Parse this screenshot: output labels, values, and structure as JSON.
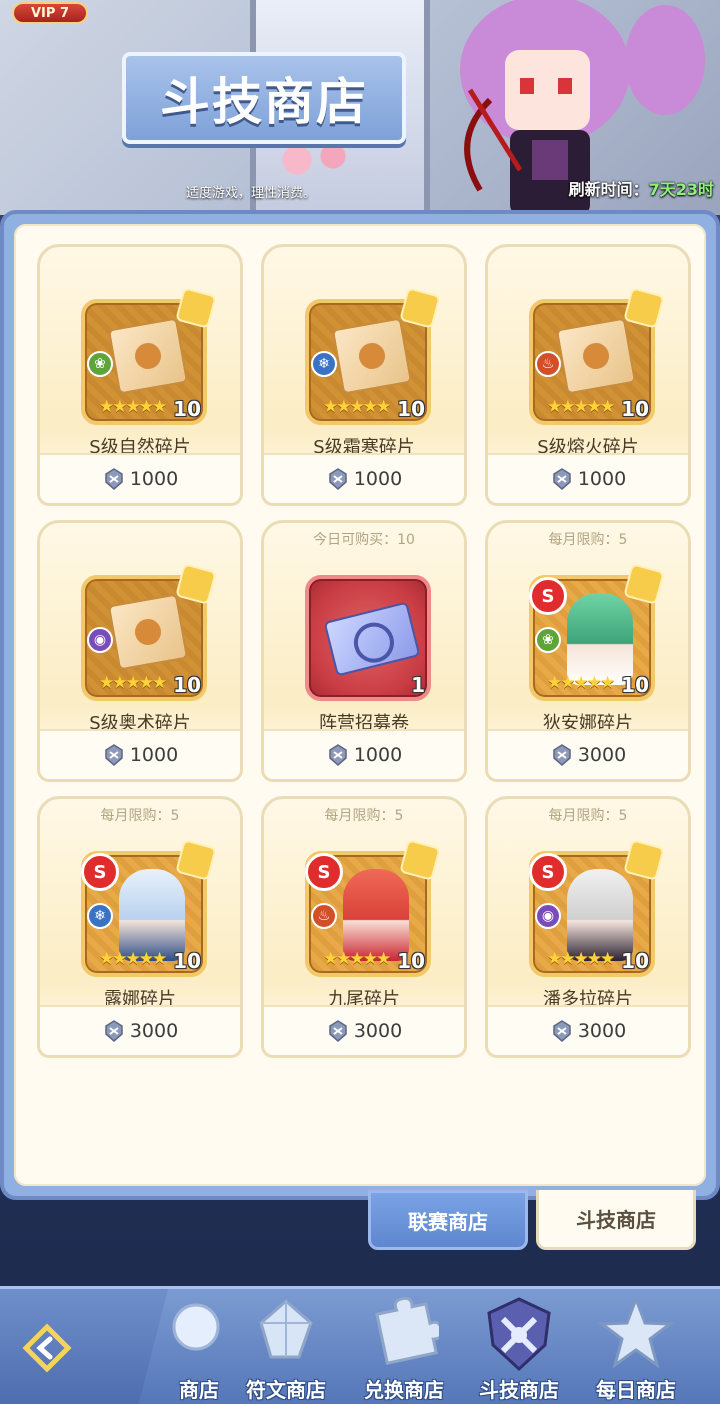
{
  "header": {
    "vip": "VIP 7",
    "title": "斗技商店",
    "tip": "适度游戏，理性消费。",
    "refresh_label": "刷新时间：",
    "refresh_time": "7天23时"
  },
  "items": [
    {
      "name": "S级自然碎片",
      "price": "1000",
      "qty": "10",
      "stars": "★★★★★",
      "limit": "",
      "element": "nature-icon"
    },
    {
      "name": "S级霜寒碎片",
      "price": "1000",
      "qty": "10",
      "stars": "★★★★★",
      "limit": "",
      "element": "frost-icon"
    },
    {
      "name": "S级熔火碎片",
      "price": "1000",
      "qty": "10",
      "stars": "★★★★★",
      "limit": "",
      "element": "fire-icon"
    },
    {
      "name": "S级奥术碎片",
      "price": "1000",
      "qty": "10",
      "stars": "★★★★★",
      "limit": "",
      "element": "arcane-icon"
    },
    {
      "name": "阵营招募卷",
      "price": "1000",
      "qty": "1",
      "stars": "",
      "limit": "今日可购买：10",
      "element": "ticket-icon"
    },
    {
      "name": "狄安娜碎片",
      "price": "3000",
      "qty": "10",
      "stars": "★★★★★",
      "limit": "每月限购：5",
      "element": "nature-icon"
    },
    {
      "name": "露娜碎片",
      "price": "3000",
      "qty": "10",
      "stars": "★★★★★",
      "limit": "每月限购：5",
      "element": "frost-icon"
    },
    {
      "name": "九尾碎片",
      "price": "3000",
      "qty": "10",
      "stars": "★★★★★",
      "limit": "每月限购：5",
      "element": "fire-icon"
    },
    {
      "name": "潘多拉碎片",
      "price": "3000",
      "qty": "10",
      "stars": "★★★★★",
      "limit": "每月限购：5",
      "element": "arcane-icon"
    }
  ],
  "subtabs": {
    "league": "联赛商店",
    "arena": "斗技商店"
  },
  "nav": [
    {
      "label": "商店"
    },
    {
      "label": "符文商店"
    },
    {
      "label": "兑换商店"
    },
    {
      "label": "斗技商店"
    },
    {
      "label": "每日商店"
    }
  ],
  "colors": {
    "panel_border": "#6d8ac7",
    "panel_bg": "#fffbf0",
    "nav_bg": "#5577b8",
    "star": "#ffd23a",
    "refresh_time": "#8df27a"
  }
}
